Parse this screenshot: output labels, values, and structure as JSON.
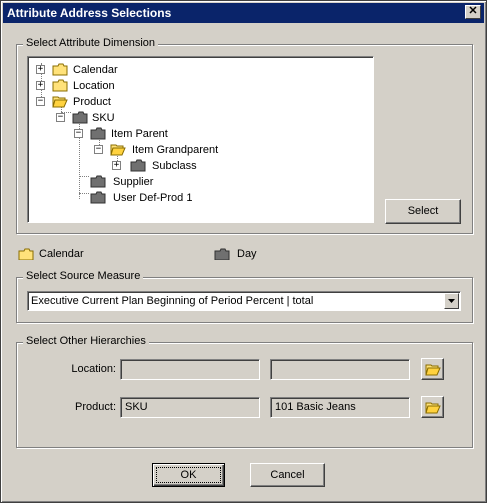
{
  "window": {
    "title": "Attribute Address Selections",
    "close_glyph": "✕"
  },
  "dimension_group": {
    "legend": "Select Attribute Dimension",
    "tree": [
      {
        "label": "Calendar",
        "expander": "+",
        "icon": "folder-closed-yellow-icon"
      },
      {
        "label": "Location",
        "expander": "+",
        "icon": "folder-closed-yellow-icon"
      },
      {
        "label": "Product",
        "expander": "−",
        "icon": "folder-open-yellow-icon"
      },
      {
        "label": "SKU",
        "expander": "−",
        "icon": "folder-dark-icon"
      },
      {
        "label": "Item Parent",
        "expander": "−",
        "icon": "folder-dark-icon"
      },
      {
        "label": "Item Grandparent",
        "expander": "−",
        "icon": "folder-open-yellow-icon"
      },
      {
        "label": "Subclass",
        "expander": "+",
        "icon": "folder-dark-icon"
      },
      {
        "label": "Supplier",
        "expander": "",
        "icon": "folder-dark-icon"
      },
      {
        "label": "User Def-Prod 1",
        "expander": "",
        "icon": "folder-dark-icon"
      }
    ],
    "select_button": "Select"
  },
  "selection": {
    "dimension_label": "Calendar",
    "level_label": "Day"
  },
  "measure_group": {
    "legend": "Select Source Measure",
    "selected_value": "Executive Current Plan Beginning of Period Percent | total"
  },
  "hierarchies_group": {
    "legend": "Select Other Hierarchies",
    "location": {
      "label": "Location:",
      "value1": "",
      "value2": ""
    },
    "product": {
      "label": "Product:",
      "value1": "SKU",
      "value2": "101 Basic Jeans"
    }
  },
  "footer": {
    "ok_label": "OK",
    "cancel_label": "Cancel"
  },
  "colors": {
    "title_bar": "#0a246a",
    "dialog_bg": "#d4d0c8",
    "folder_yellow": "#ffe27a",
    "folder_dark": "#707070"
  }
}
